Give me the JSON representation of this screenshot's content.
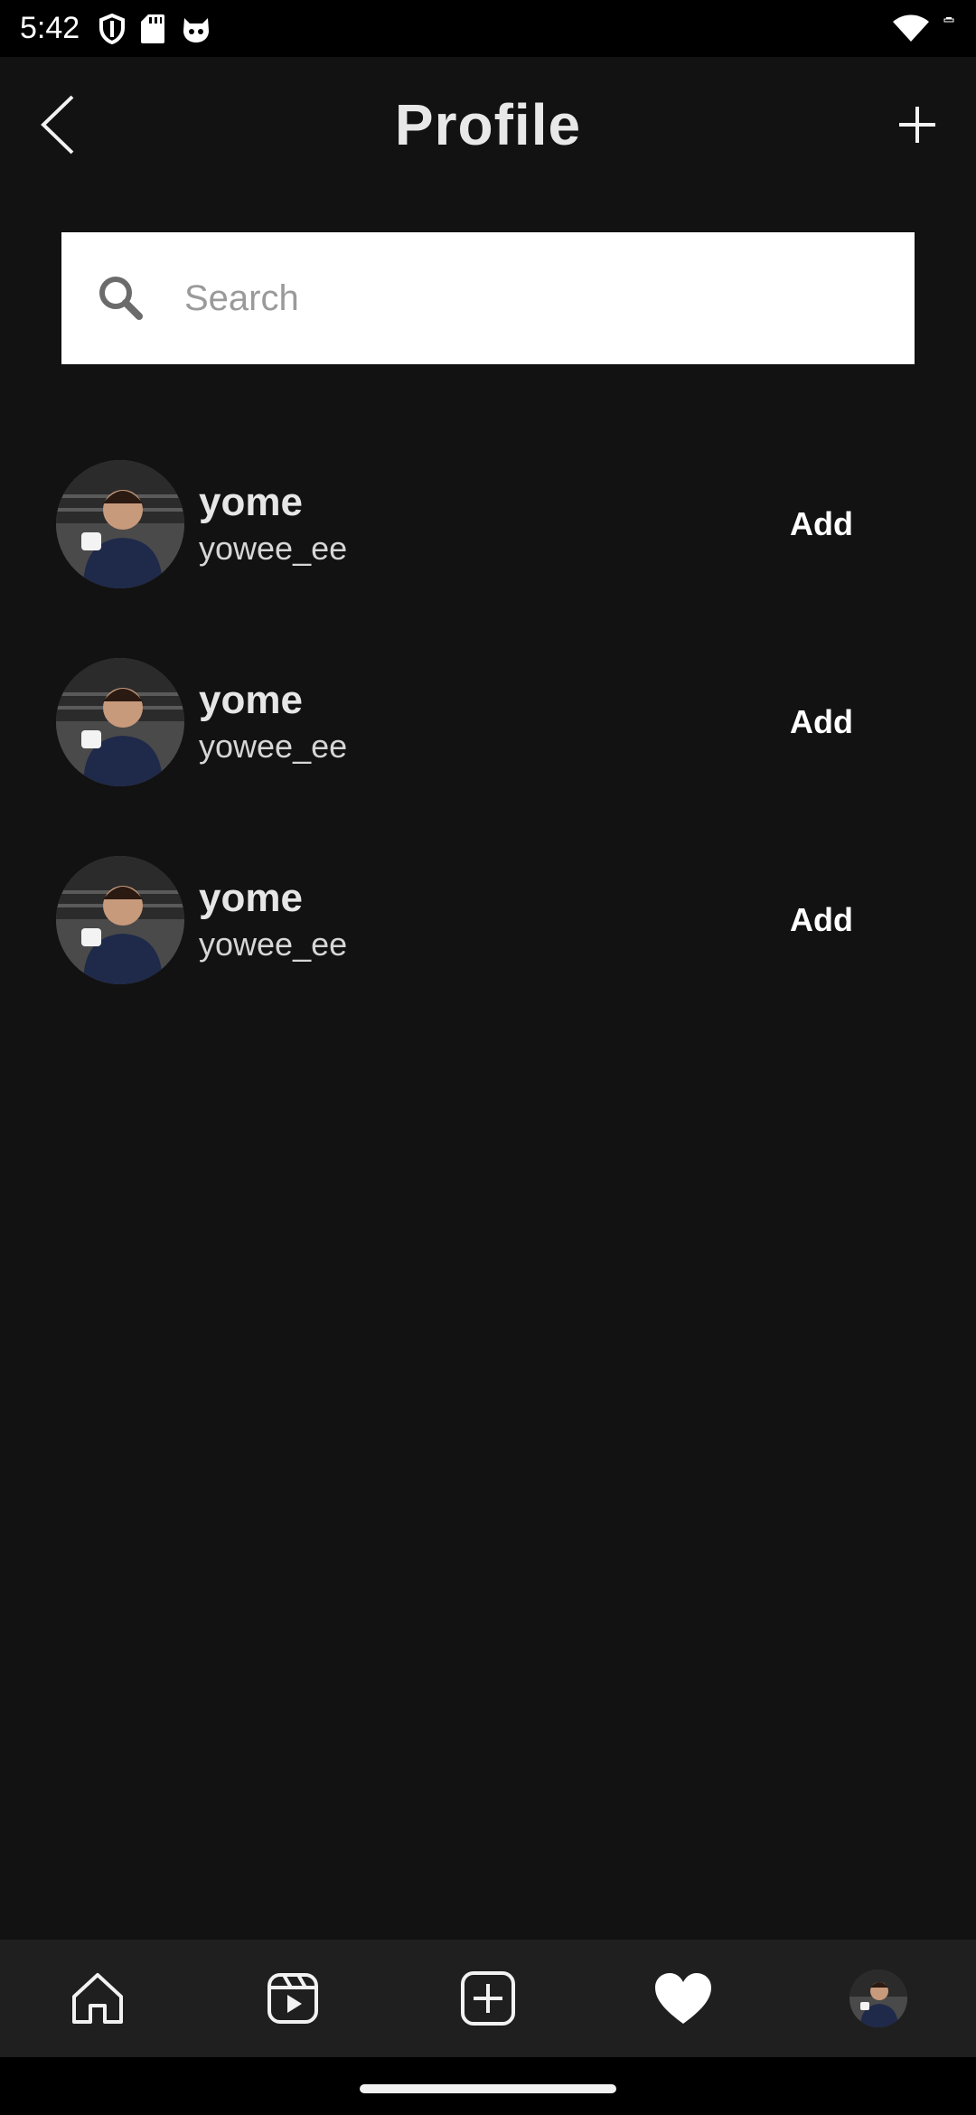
{
  "status_bar": {
    "time": "5:42",
    "icons": [
      "shield-icon",
      "sd-card-icon",
      "cat-icon",
      "wifi-icon",
      "battery-icon"
    ]
  },
  "header": {
    "title": "Profile",
    "back_icon": "chevron-left-icon",
    "add_icon": "plus-icon"
  },
  "search": {
    "placeholder": "Search",
    "value": ""
  },
  "users": [
    {
      "display_name": "yome",
      "username": "yowee_ee",
      "action_label": "Add"
    },
    {
      "display_name": "yome",
      "username": "yowee_ee",
      "action_label": "Add"
    },
    {
      "display_name": "yome",
      "username": "yowee_ee",
      "action_label": "Add"
    }
  ],
  "bottom_nav": {
    "items": [
      "home-icon",
      "reels-icon",
      "create-post-icon",
      "heart-icon",
      "profile-avatar"
    ],
    "active": "heart-icon"
  },
  "colors": {
    "background": "#121212",
    "nav_background": "#1f1f1f",
    "status_bar": "#000000",
    "search_background": "#ffffff",
    "text_primary": "#e6e6e6"
  }
}
